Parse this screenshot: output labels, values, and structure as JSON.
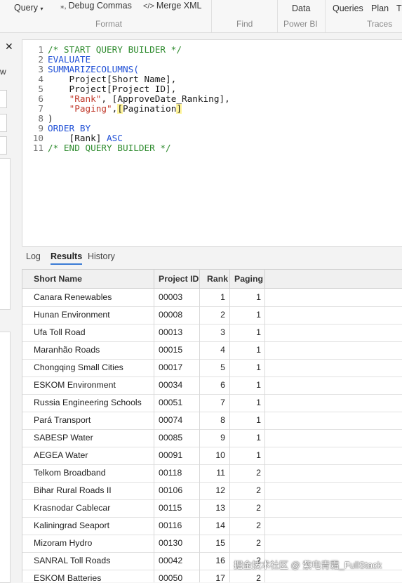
{
  "ribbon": {
    "query_label": "Query",
    "debug_commas": "Debug Commas",
    "merge_xml": "Merge XML",
    "format_group": "Format",
    "find_group": "Find",
    "data_label": "Data",
    "powerbi_group": "Power BI",
    "queries_label": "Queries",
    "plan_label": "Plan",
    "tr_label": "Tr",
    "traces_group": "Traces"
  },
  "left_rail": {
    "close_glyph": "✕",
    "partial_text": "w"
  },
  "editor": {
    "lines": [
      {
        "n": "1"
      },
      {
        "n": "2"
      },
      {
        "n": "3"
      },
      {
        "n": "4"
      },
      {
        "n": "5"
      },
      {
        "n": "6"
      },
      {
        "n": "7"
      },
      {
        "n": "8"
      },
      {
        "n": "9"
      },
      {
        "n": "10"
      },
      {
        "n": "11"
      }
    ],
    "tokens": {
      "l1": "/* START QUERY BUILDER */",
      "l2": "EVALUATE",
      "l3": "SUMMARIZECOLUMNS(",
      "l4": "    Project[Short Name],",
      "l5": "    Project[Project ID],",
      "l6_str": "\"Rank\"",
      "l6_rest": ", [ApproveDate_Ranking],",
      "l7_str": "\"Paging\"",
      "l7_comma": ",",
      "l7_open": "[",
      "l7_mid": "Pagination",
      "l7_close": "]",
      "l8": ")",
      "l9": "ORDER BY",
      "l10_a": "    [Rank] ",
      "l10_b": "ASC",
      "l11": "/* END QUERY BUILDER */"
    }
  },
  "output_tabs": {
    "log": "Log",
    "results": "Results",
    "history": "History"
  },
  "results": {
    "headers": [
      "Short Name",
      "Project ID",
      "Rank",
      "Paging"
    ],
    "rows": [
      [
        "Canara Renewables",
        "00003",
        "1",
        "1"
      ],
      [
        "Hunan Environment",
        "00008",
        "2",
        "1"
      ],
      [
        "Ufa Toll Road",
        "00013",
        "3",
        "1"
      ],
      [
        "Maranhão Roads",
        "00015",
        "4",
        "1"
      ],
      [
        "Chongqing Small Cities",
        "00017",
        "5",
        "1"
      ],
      [
        "ESKOM Environment",
        "00034",
        "6",
        "1"
      ],
      [
        "Russia Engineering Schools",
        "00051",
        "7",
        "1"
      ],
      [
        "Pará Transport",
        "00074",
        "8",
        "1"
      ],
      [
        "SABESP Water",
        "00085",
        "9",
        "1"
      ],
      [
        "AEGEA Water",
        "00091",
        "10",
        "1"
      ],
      [
        "Telkom Broadband",
        "00118",
        "11",
        "2"
      ],
      [
        "Bihar Rural Roads II",
        "00106",
        "12",
        "2"
      ],
      [
        "Krasnodar Cablecar",
        "00115",
        "13",
        "2"
      ],
      [
        "Kaliningrad Seaport",
        "00116",
        "14",
        "2"
      ],
      [
        "Mizoram Hydro",
        "00130",
        "15",
        "2"
      ],
      [
        "SANRAL Toll Roads",
        "00042",
        "16",
        "2"
      ],
      [
        "ESKOM Batteries",
        "00050",
        "17",
        "2"
      ]
    ]
  },
  "watermark": "掘金技术社区 @ 紫电青霜_FullStack",
  "colors": {
    "comment": "#2e8b2e",
    "keyword": "#1f4fd6",
    "string": "#c0392b",
    "highlight": "#fff59d",
    "tab_underline": "#3a7bd5"
  }
}
